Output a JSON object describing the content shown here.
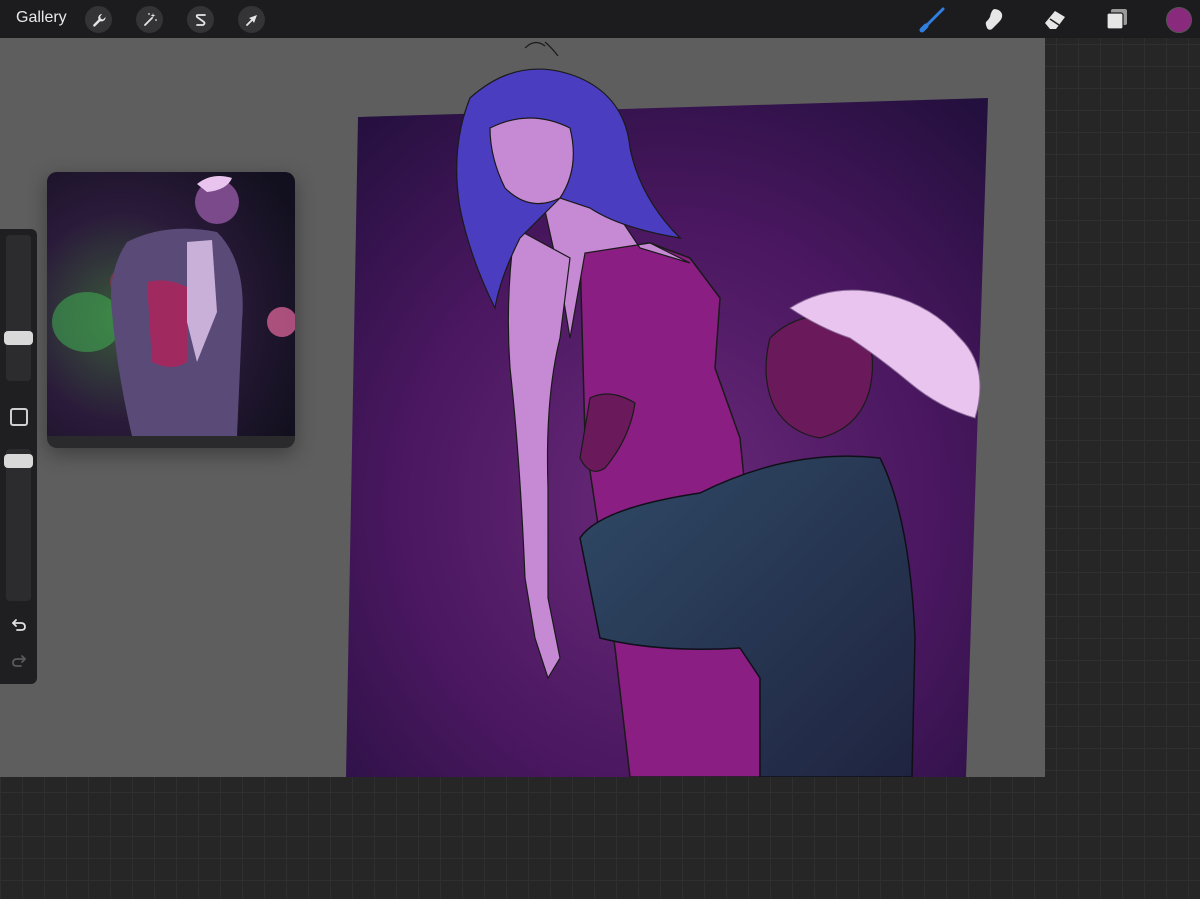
{
  "toolbar": {
    "gallery_label": "Gallery",
    "left_tools": [
      {
        "name": "actions",
        "icon": "wrench-icon"
      },
      {
        "name": "adjustments",
        "icon": "magic-wand-icon"
      },
      {
        "name": "selection",
        "icon": "selection-s-icon"
      },
      {
        "name": "transform",
        "icon": "arrow-cursor-icon"
      }
    ],
    "right_tools": [
      {
        "name": "brush",
        "icon": "brush-icon",
        "active": true
      },
      {
        "name": "smudge",
        "icon": "smudge-icon",
        "active": false
      },
      {
        "name": "eraser",
        "icon": "eraser-icon",
        "active": false
      },
      {
        "name": "layers",
        "icon": "layers-icon",
        "active": false
      }
    ],
    "active_color": "#8a2a7c",
    "active_tool_color": "#2f7fe0"
  },
  "sidebar": {
    "brush_size_level": 0.33,
    "opacity_level": 0.95,
    "undo_icon": "undo-icon",
    "redo_icon": "redo-icon"
  },
  "reference_window": {
    "visible": true
  },
  "colors": {
    "canvas_bg": "#5e5e5e",
    "art_bg_top": "#2a0f48",
    "art_bg_mid": "#5a1a6a",
    "dress": "#8e1f86",
    "skin_light": "#c98ed6",
    "hair_blue": "#4b3ec0",
    "suit": "#2b3b5a"
  }
}
